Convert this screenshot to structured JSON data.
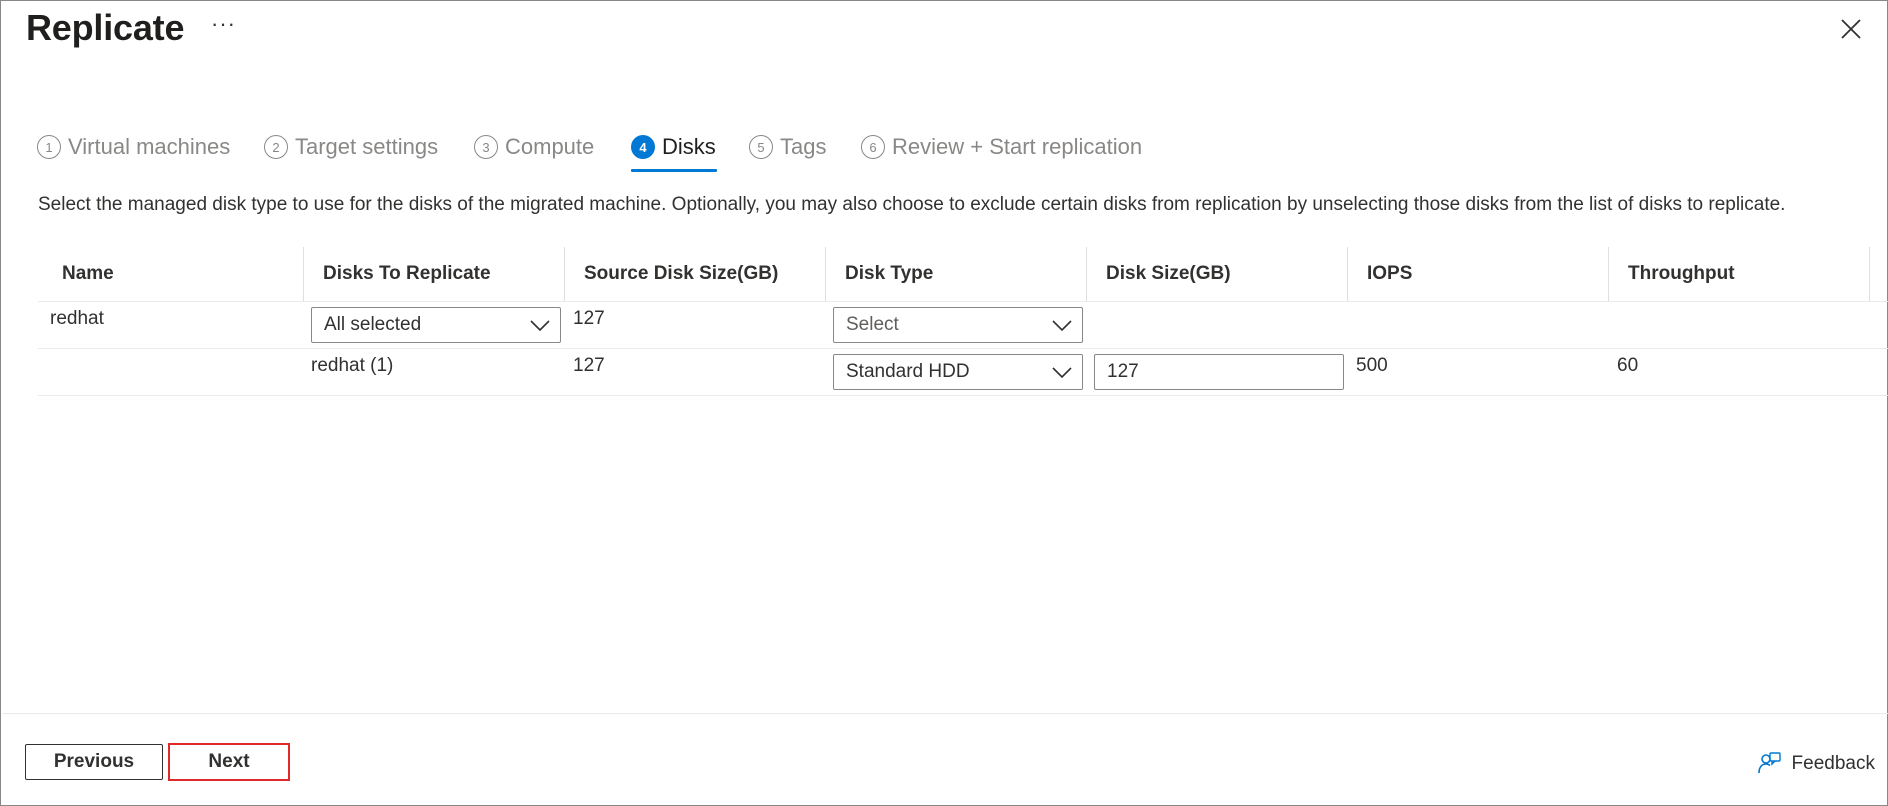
{
  "header": {
    "title": "Replicate",
    "more_label": "···",
    "close_icon": "close-icon"
  },
  "tabs": [
    {
      "num": "1",
      "label": "Virtual machines",
      "active": false
    },
    {
      "num": "2",
      "label": "Target settings",
      "active": false
    },
    {
      "num": "3",
      "label": "Compute",
      "active": false
    },
    {
      "num": "4",
      "label": "Disks",
      "active": true
    },
    {
      "num": "5",
      "label": "Tags",
      "active": false
    },
    {
      "num": "6",
      "label": "Review + Start replication",
      "active": false
    }
  ],
  "description": "Select the managed disk type to use for the disks of the migrated machine. Optionally, you may also choose to exclude certain disks from replication by unselecting those disks from the list of disks to replicate.",
  "table": {
    "columns": [
      "Name",
      "Disks To Replicate",
      "Source Disk Size(GB)",
      "Disk Type",
      "Disk Size(GB)",
      "IOPS",
      "Throughput"
    ],
    "rows": [
      {
        "name": "redhat",
        "disks_to_replicate": "All selected",
        "source_disk_size": "127",
        "disk_type": "Select",
        "disk_size": "",
        "iops": "",
        "throughput": ""
      },
      {
        "name": "",
        "disks_to_replicate": "redhat (1)",
        "source_disk_size": "127",
        "disk_type": "Standard HDD",
        "disk_size": "127",
        "iops": "500",
        "throughput": "60"
      }
    ]
  },
  "footer": {
    "previous_label": "Previous",
    "next_label": "Next",
    "feedback_label": "Feedback"
  },
  "colors": {
    "accent": "#0078d4",
    "highlight": "#e02a2a"
  }
}
